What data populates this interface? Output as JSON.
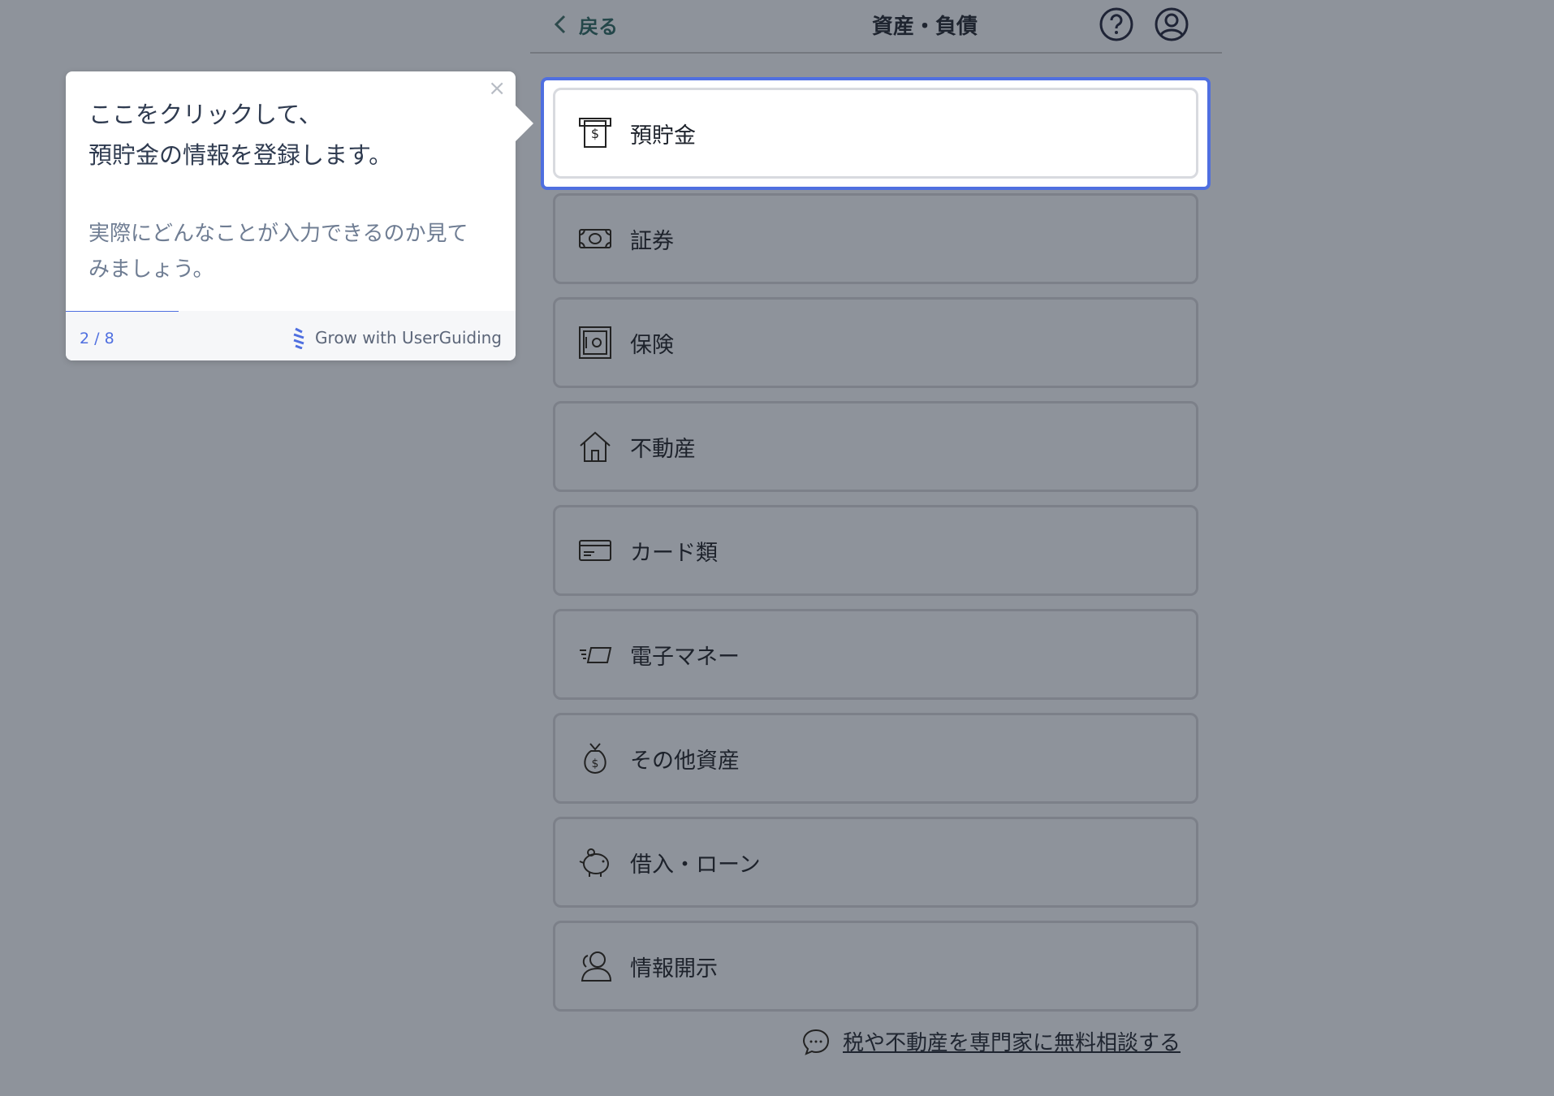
{
  "header": {
    "back_label": "戻る",
    "title": "資産・負債"
  },
  "items": [
    {
      "label": "預貯金",
      "icon": "atm-icon"
    },
    {
      "label": "証券",
      "icon": "banknote-icon"
    },
    {
      "label": "保険",
      "icon": "safe-icon"
    },
    {
      "label": "不動産",
      "icon": "house-icon"
    },
    {
      "label": "カード類",
      "icon": "card-icon"
    },
    {
      "label": "電子マネー",
      "icon": "e-money-icon"
    },
    {
      "label": "その他資産",
      "icon": "money-bag-icon"
    },
    {
      "label": "借入・ローン",
      "icon": "piggy-bank-icon"
    },
    {
      "label": "情報開示",
      "icon": "person-icon"
    }
  ],
  "consult_link": "税や不動産を専門家に無料相談する",
  "tooltip": {
    "heading_line1": "ここをクリックして、",
    "heading_line2": "預貯金の情報を登録します。",
    "body_line1": "実際にどんなことが入力できるのか見て",
    "body_line2": "みましょう。",
    "step": "2 / 8",
    "progress": 0.25,
    "brand": "Grow with UserGuiding"
  },
  "colors": {
    "accent": "#4f6fe0",
    "backdrop": "#8e939b"
  }
}
